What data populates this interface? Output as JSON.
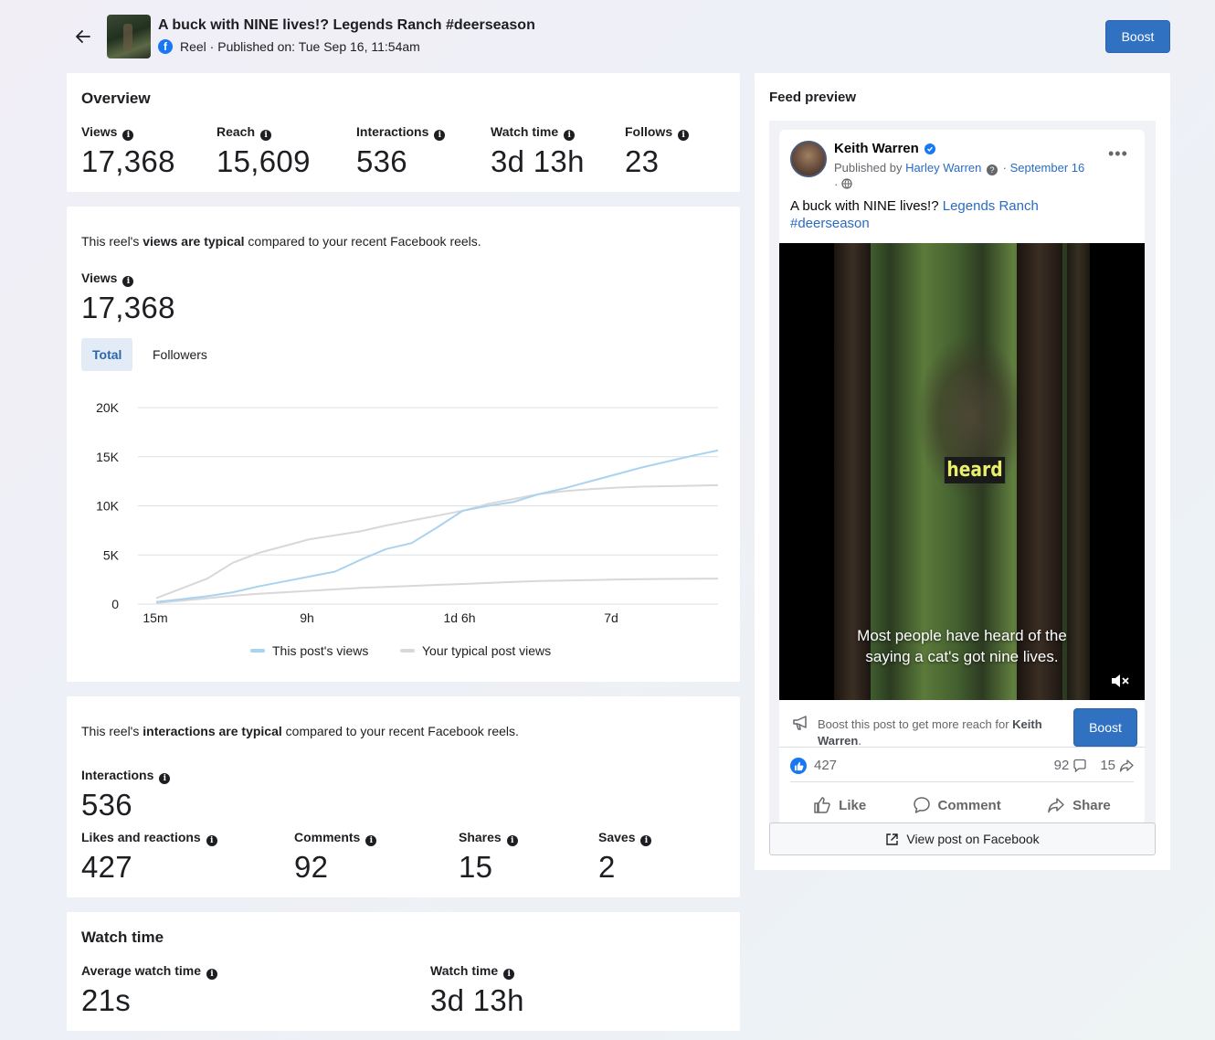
{
  "header": {
    "title": "A buck with NINE lives!? Legends Ranch #deerseason",
    "subtitle": "Reel · Published on: Tue Sep 16, 11:54am",
    "boost_label": "Boost"
  },
  "overview": {
    "title": "Overview",
    "metrics": [
      {
        "label": "Views",
        "value": "17,368"
      },
      {
        "label": "Reach",
        "value": "15,609"
      },
      {
        "label": "Interactions",
        "value": "536"
      },
      {
        "label": "Watch time",
        "value": "3d 13h"
      },
      {
        "label": "Follows",
        "value": "23"
      }
    ]
  },
  "views_section": {
    "sentence_pre": "This reel's ",
    "sentence_bold": "views are typical",
    "sentence_post": " compared to your recent Facebook reels.",
    "label": "Views",
    "value": "17,368",
    "tabs": [
      "Total",
      "Followers"
    ],
    "active_tab": "Total"
  },
  "chart_data": {
    "type": "line",
    "x_ticks": [
      "15m",
      "9h",
      "1d 6h",
      "7d"
    ],
    "y_ticks": [
      "20K",
      "15K",
      "10K",
      "5K",
      "0"
    ],
    "ylim": [
      0,
      20000
    ],
    "grid": true,
    "legend_position": "bottom",
    "legend": [
      "This post's views",
      "Your typical post views"
    ],
    "series": [
      {
        "name": "This post's views",
        "color": "#a9d3f0",
        "values": [
          200,
          500,
          800,
          1200,
          1800,
          2300,
          2800,
          3300,
          4500,
          5600,
          6200,
          7800,
          9500,
          10000,
          10400,
          11200,
          11800,
          12500,
          13200,
          13900,
          14500,
          15100,
          15650
        ]
      },
      {
        "name": "Your typical post views",
        "color": "#d8d8da",
        "values": [
          600,
          1600,
          2600,
          4200,
          5200,
          5900,
          6600,
          7000,
          7400,
          8000,
          8500,
          9000,
          9500,
          10200,
          10700,
          11200,
          11500,
          11700,
          11850,
          11950,
          12000,
          12050,
          12100
        ]
      },
      {
        "name": "Your typical post views (lower range)",
        "color": "#d8d8da",
        "values": [
          100,
          350,
          600,
          850,
          1050,
          1200,
          1350,
          1500,
          1650,
          1750,
          1850,
          1950,
          2050,
          2150,
          2250,
          2350,
          2400,
          2450,
          2500,
          2530,
          2560,
          2580,
          2600
        ]
      }
    ]
  },
  "interactions_section": {
    "sentence_pre": "This reel's ",
    "sentence_bold": "interactions are typical",
    "sentence_post": " compared to your recent Facebook reels.",
    "label": "Interactions",
    "value": "536",
    "breakdown": [
      {
        "label": "Likes and reactions",
        "value": "427"
      },
      {
        "label": "Comments",
        "value": "92"
      },
      {
        "label": "Shares",
        "value": "15"
      },
      {
        "label": "Saves",
        "value": "2"
      }
    ]
  },
  "watch_section": {
    "title": "Watch time",
    "metrics": [
      {
        "label": "Average watch time",
        "value": "21s"
      },
      {
        "label": "Watch time",
        "value": "3d 13h"
      }
    ]
  },
  "feed_preview": {
    "title": "Feed preview",
    "author": "Keith Warren",
    "published_by_prefix": "Published by ",
    "publisher": "Harley Warren",
    "date": "September 16",
    "caption_text": "A buck with NINE lives!? ",
    "caption_link": "Legends Ranch",
    "caption_tag": "#deerseason",
    "video_word": "heard",
    "video_caption_line1": "Most people have heard of the",
    "video_caption_line2": "saying a cat's got nine lives.",
    "boost_text_pre": "Boost this post to get more reach for ",
    "boost_text_bold": "Keith Warren",
    "boost_text_post": ".",
    "boost_label": "Boost",
    "reactions_count": "427",
    "comments_count": "92",
    "shares_count": "15",
    "actions": [
      "Like",
      "Comment",
      "Share"
    ],
    "view_on_facebook": "View post on Facebook"
  },
  "colors": {
    "accent": "#3171c2",
    "link": "#2a6bc2",
    "series_post": "#a9d3f0",
    "series_typical": "#d8d8da"
  }
}
